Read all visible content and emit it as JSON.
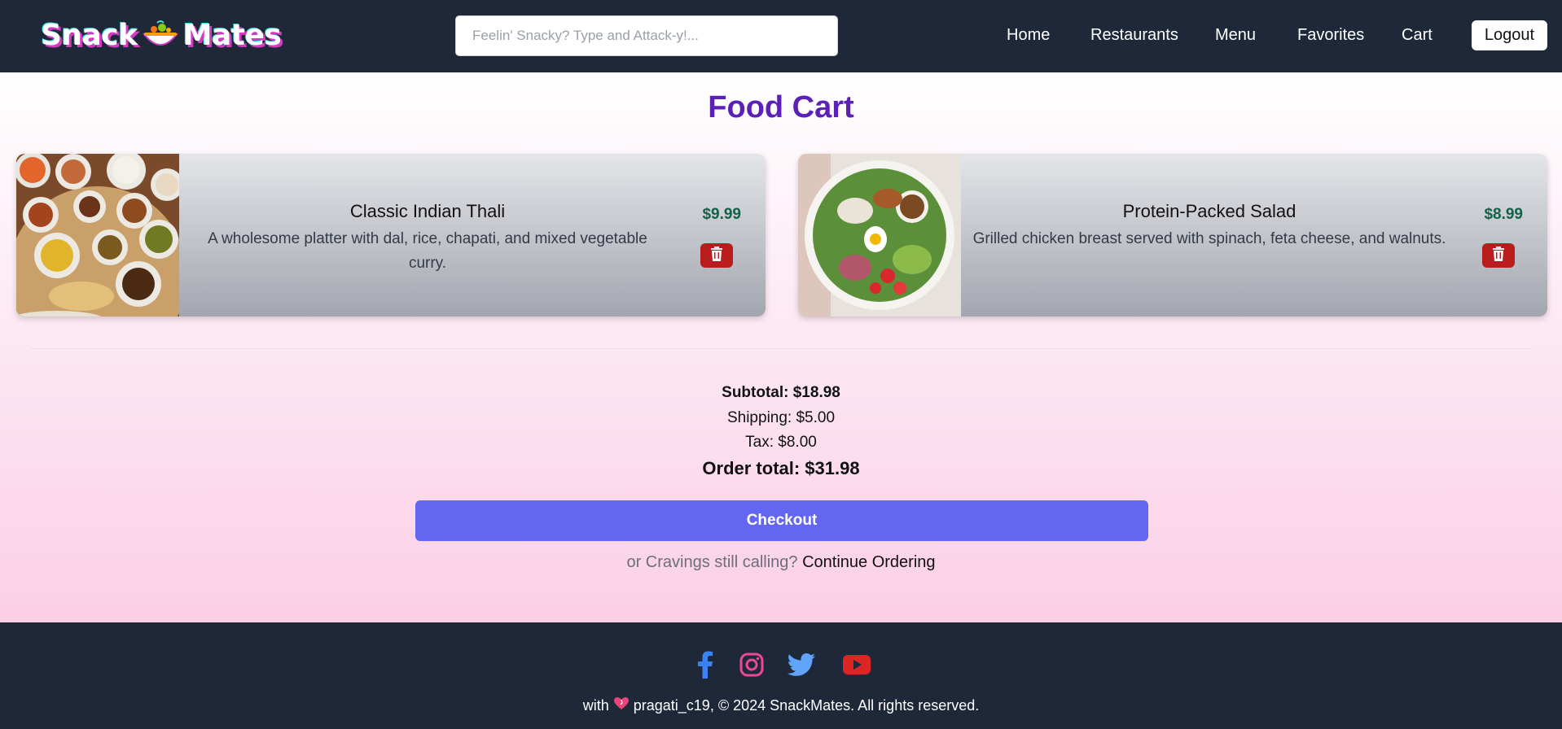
{
  "header": {
    "logo_left": "Snack",
    "logo_right": "Mates",
    "search_placeholder": "Feelin' Snacky? Type and Attack-y!...",
    "nav": [
      "Home",
      "Restaurants",
      "Menu",
      "Favorites",
      "Cart"
    ],
    "logout_label": "Logout"
  },
  "main": {
    "title": "Food Cart",
    "items": [
      {
        "name": "Classic Indian Thali",
        "description": "A wholesome platter with dal, rice, chapati, and mixed vegetable curry.",
        "price": "$9.99",
        "image_icon": "thali-photo",
        "remove_icon": "trash-icon"
      },
      {
        "name": "Protein-Packed Salad",
        "description": "Grilled chicken breast served with spinach, feta cheese, and walnuts.",
        "price": "$8.99",
        "image_icon": "salad-photo",
        "remove_icon": "trash-icon"
      }
    ],
    "summary": {
      "subtotal": "Subtotal: $18.98",
      "shipping": "Shipping: $5.00",
      "tax": "Tax: $8.00",
      "order_total": "Order total: $31.98"
    },
    "checkout_label": "Checkout",
    "continue_prefix": "or Cravings still calling?",
    "continue_link": "Continue Ordering"
  },
  "footer": {
    "socials": [
      "facebook-icon",
      "instagram-icon",
      "twitter-icon",
      "youtube-icon"
    ],
    "text_prefix": "with",
    "text_suffix": "pragati_c19, © 2024 SnackMates. All rights reserved."
  },
  "colors": {
    "header_bg": "#1f2839",
    "title": "#5b21b6",
    "price": "#14614a",
    "remove_button": "#b91c1c",
    "checkout": "#6366f1"
  }
}
